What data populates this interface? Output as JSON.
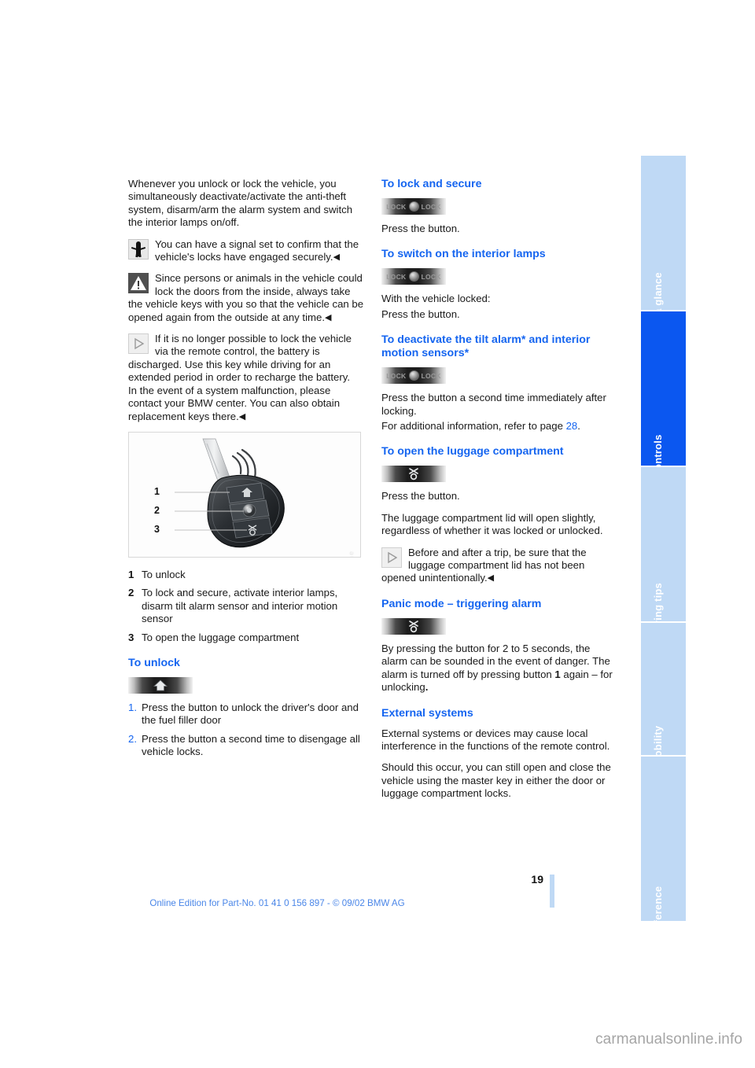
{
  "document": {
    "page_number": "19",
    "online_edition": "Online Edition for Part-No. 01 41 0 156 897 - © 09/02 BMW AG",
    "watermark": "carmanualsonline.info"
  },
  "sidebar": {
    "tabs": [
      {
        "label": "At a glance",
        "active": false
      },
      {
        "label": "Controls",
        "active": true
      },
      {
        "label": "Driving tips",
        "active": false
      },
      {
        "label": "Mobility",
        "active": false
      },
      {
        "label": "Reference",
        "active": false
      }
    ],
    "active_color": "#0b57f0",
    "inactive_color": "#bfd9f5"
  },
  "left_column": {
    "intro_paragraph": "Whenever you unlock or lock the vehicle, you simultaneously deactivate/activate the anti-theft system, disarm/arm the alarm system and switch the interior lamps on/off.",
    "note_signal": {
      "icon": "signal-person-icon",
      "text": "You can have a signal set to confirm that the vehicle's locks have engaged securely.",
      "end_marker": "◀"
    },
    "note_warning": {
      "icon": "warning-triangle-icon",
      "text": "Since persons or animals in the vehicle could lock the doors from the inside, always take the vehicle keys with you so that the vehicle can be opened again from the outside at any time.",
      "end_marker": "◀"
    },
    "note_info": {
      "icon": "note-triangle-icon",
      "text_part1": "If it is no longer possible to lock the vehicle via the remote control, the battery is discharged. Use this key while driving for an extended period in order to recharge the battery.",
      "text_part2": "In the event of a system malfunction, please contact your BMW center. You can also obtain replacement keys there.",
      "end_marker": "◀"
    },
    "figure": {
      "name": "bmw-key-fob-illustration",
      "watermark": "carmanualsonline",
      "callouts": [
        "1",
        "2",
        "3"
      ]
    },
    "legend": [
      {
        "num": "1",
        "text": "To unlock"
      },
      {
        "num": "2",
        "text": "To lock and secure, activate interior lamps, disarm tilt alarm sensor and interior motion sensor"
      },
      {
        "num": "3",
        "text": "To open the luggage compartment"
      }
    ],
    "to_unlock": {
      "heading": "To unlock",
      "button_icon": "unlock-button-icon",
      "steps": [
        {
          "num": "1.",
          "text": "Press the button to unlock the driver's door and the fuel filler door"
        },
        {
          "num": "2.",
          "text": "Press the button a second time to disengage all vehicle locks."
        }
      ]
    }
  },
  "right_column": {
    "to_lock_and_secure": {
      "heading": "To lock and secure",
      "button_icon": "lock-button-icon",
      "button_label": "LOCK",
      "text": "Press the button."
    },
    "to_switch_on_interior_lamps": {
      "heading": "To switch on the interior lamps",
      "button_icon": "lock-button-icon",
      "button_label": "LOCK",
      "line1": "With the vehicle locked:",
      "line2": "Press the button."
    },
    "to_deactivate_tilt_alarm": {
      "heading": "To deactivate the tilt alarm* and interior motion sensors*",
      "button_icon": "lock-button-icon",
      "button_label": "LOCK",
      "line1": "Press the button a second time immediately after locking.",
      "line2_prefix": "For additional information, refer to page ",
      "line2_page": "28",
      "line2_suffix": "."
    },
    "to_open_luggage_compartment": {
      "heading": "To open the luggage compartment",
      "button_icon": "trunk-button-icon",
      "line1": "Press the button.",
      "line2": "The luggage compartment lid will open slightly, regardless of whether it was locked or unlocked.",
      "note": {
        "icon": "note-triangle-icon",
        "text": "Before and after a trip, be sure that the luggage compartment lid has not been opened unintentionally.",
        "end_marker": "◀"
      }
    },
    "panic_mode": {
      "heading": "Panic mode – triggering alarm",
      "button_icon": "trunk-button-icon",
      "text_part1": "By pressing the button for 2 to 5 seconds, the alarm can be sounded in the event of danger. The alarm is turned off by pressing button ",
      "text_bold": "1",
      "text_part2": " again – for unlocking",
      "text_end": "."
    },
    "external_systems": {
      "heading": "External systems",
      "para1": "External systems or devices may cause local interference in the functions of the remote control.",
      "para2": "Should this occur, you can still open and close the vehicle using the master key in either the door or luggage compartment locks."
    }
  }
}
